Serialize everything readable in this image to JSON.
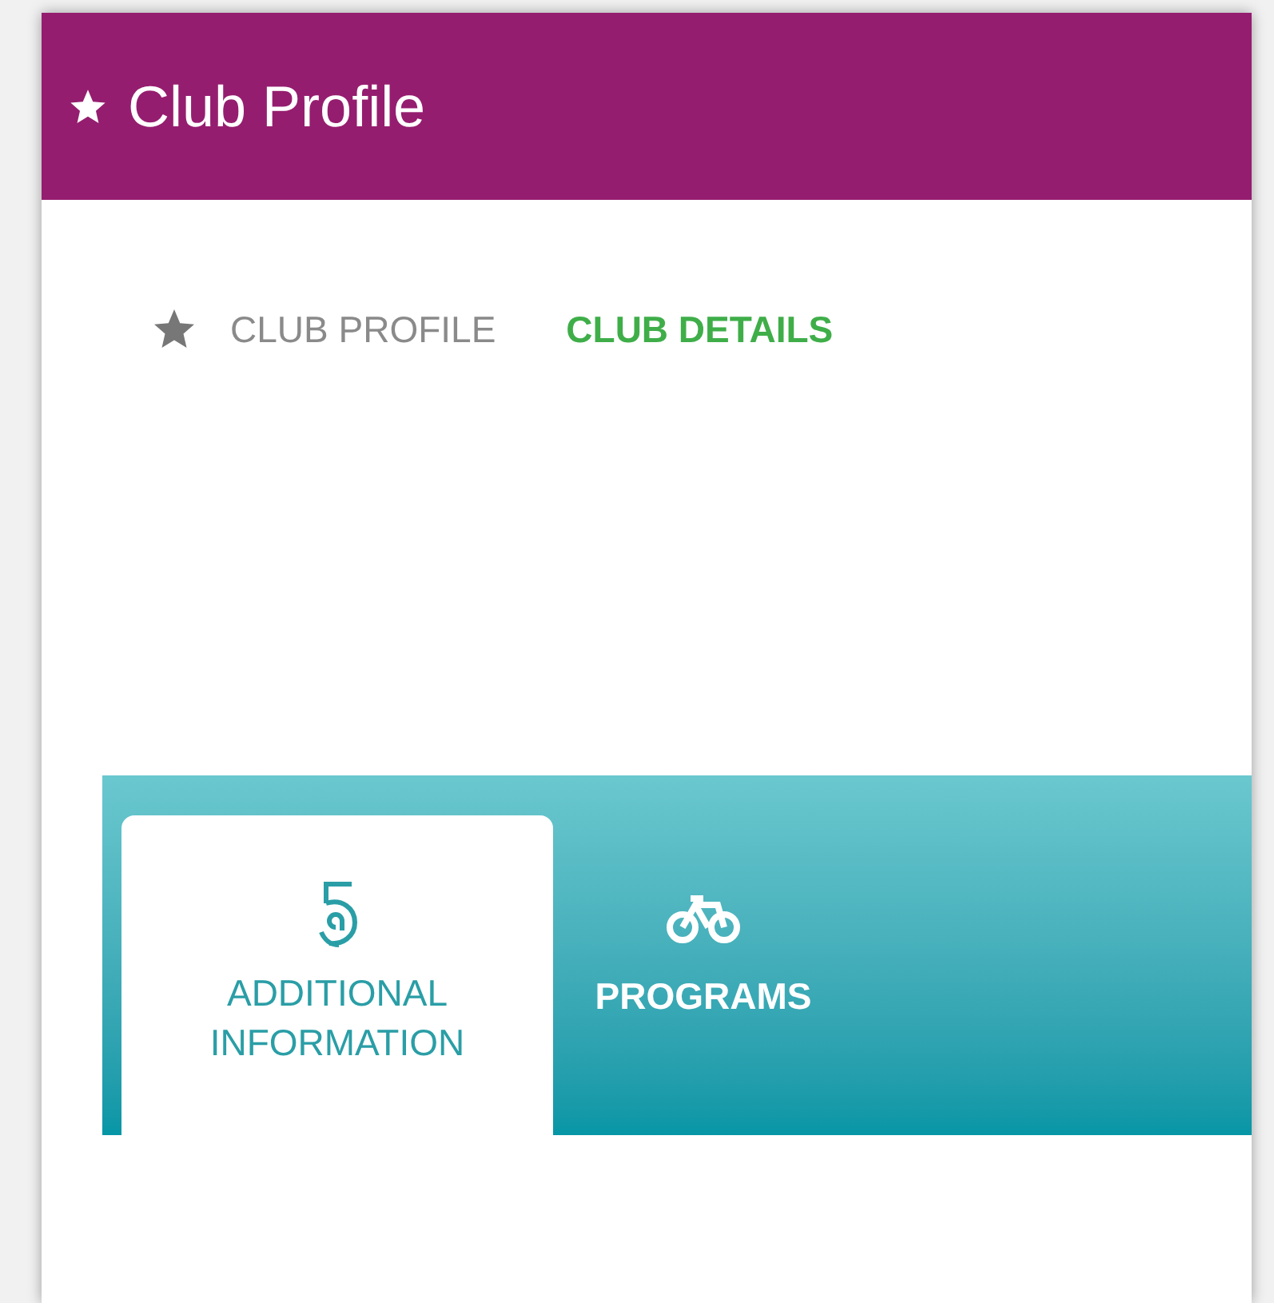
{
  "header": {
    "title": "Club Profile"
  },
  "breadcrumbs": [
    {
      "label": "CLUB PROFILE",
      "kind": "star",
      "selected": false
    },
    {
      "label": "CLUB DETAILS",
      "kind": "plain",
      "selected": true
    }
  ],
  "tabs": [
    {
      "label": "ADDITIONAL INFORMATION",
      "kind": "spiral",
      "selected": true
    },
    {
      "label": "PROGRAMS",
      "kind": "bicycle",
      "selected": false
    }
  ]
}
